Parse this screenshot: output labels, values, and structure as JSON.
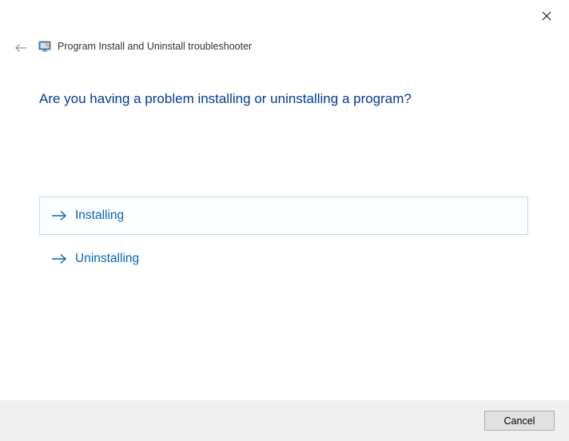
{
  "window": {
    "title": "Program Install and Uninstall troubleshooter"
  },
  "heading": "Are you having a problem installing or uninstalling a program?",
  "options": [
    {
      "label": "Installing",
      "selected": true
    },
    {
      "label": "Uninstalling",
      "selected": false
    }
  ],
  "footer": {
    "cancel_label": "Cancel"
  }
}
